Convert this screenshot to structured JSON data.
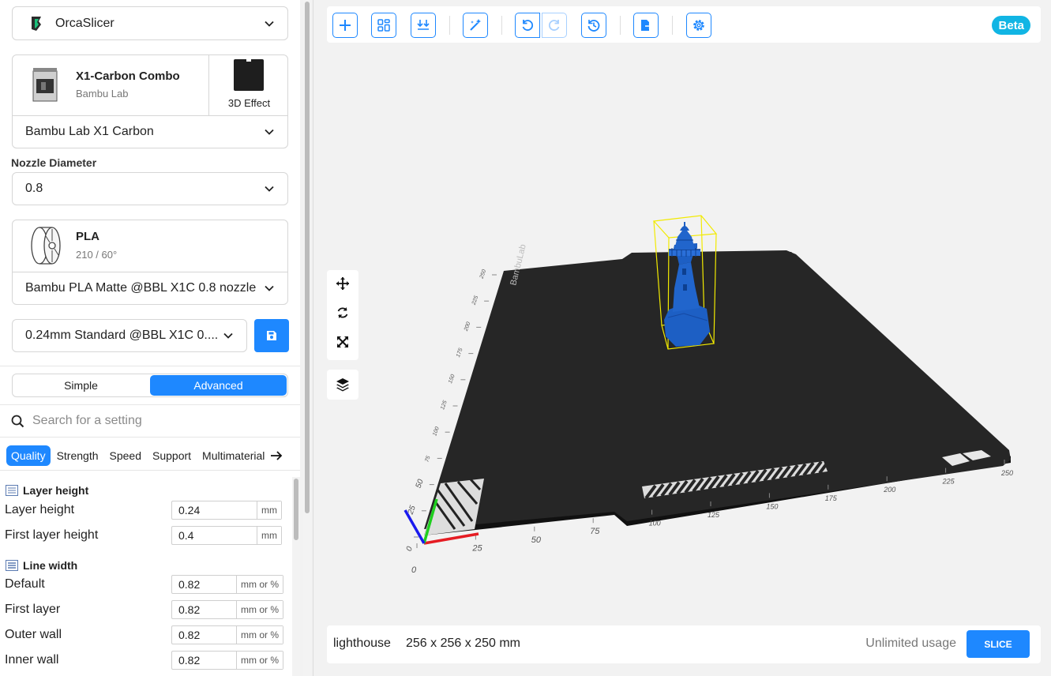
{
  "sidebar": {
    "app_selector": "OrcaSlicer",
    "printer": {
      "name": "X1-Carbon Combo",
      "brand": "Bambu Lab",
      "plate_label": "3D Effect",
      "model": "Bambu Lab X1 Carbon"
    },
    "nozzle": {
      "label": "Nozzle Diameter",
      "value": "0.8"
    },
    "filament": {
      "type": "PLA",
      "temps": "210 / 60°",
      "profile": "Bambu PLA Matte @BBL X1C 0.8 nozzle"
    },
    "process_profile": "0.24mm Standard @BBL X1C 0....",
    "mode": {
      "simple": "Simple",
      "advanced": "Advanced",
      "selected": "Advanced"
    },
    "search": {
      "placeholder": "Search for a setting"
    },
    "tabs": [
      "Quality",
      "Strength",
      "Speed",
      "Support",
      "Multimaterial"
    ],
    "active_tab": "Quality",
    "sections": {
      "layer_height": {
        "title": "Layer height",
        "rows": [
          {
            "label": "Layer height",
            "value": "0.24",
            "unit": "mm"
          },
          {
            "label": "First layer height",
            "value": "0.4",
            "unit": "mm"
          }
        ]
      },
      "line_width": {
        "title": "Line width",
        "rows": [
          {
            "label": "Default",
            "value": "0.82",
            "unit": "mm or %"
          },
          {
            "label": "First layer",
            "value": "0.82",
            "unit": "mm or %"
          },
          {
            "label": "Outer wall",
            "value": "0.82",
            "unit": "mm or %"
          },
          {
            "label": "Inner wall",
            "value": "0.82",
            "unit": "mm or %"
          }
        ]
      }
    }
  },
  "toolbar": {
    "beta": "Beta"
  },
  "viewport": {
    "plate_brand": "BambuLab",
    "axis_ticks_x": [
      "0",
      "25",
      "50",
      "75",
      "100",
      "125",
      "150",
      "175",
      "200",
      "225",
      "250"
    ],
    "axis_ticks_y": [
      "0",
      "25",
      "50",
      "75",
      "100",
      "125",
      "150",
      "175",
      "200",
      "225",
      "250"
    ]
  },
  "bottom": {
    "object_name": "lighthouse",
    "size": "256 x 256 x 250 mm",
    "usage": "Unlimited usage",
    "slice": "SLICE"
  },
  "colors": {
    "accent": "#1e88ff",
    "beta": "#11b5e4",
    "model": "#1d5fc4",
    "plate": "#262626",
    "bbox": "#f2ea00"
  }
}
